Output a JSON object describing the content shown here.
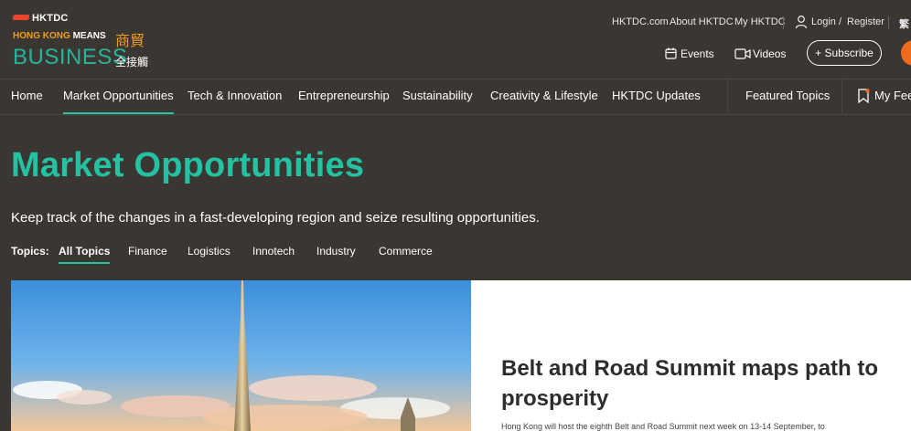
{
  "logo": {
    "brand": "HKTDC",
    "tagline_orange": "HONG KONG",
    "tagline_white": "MEANS",
    "tagline_chinese": "商貿",
    "business": "BUSINESS",
    "business_chinese": "全接觸"
  },
  "utility_links": [
    "HKTDC.com",
    "About HKTDC",
    "My HKTDC"
  ],
  "login": {
    "login_label": "Login",
    "slash": "/",
    "register_label": "Register"
  },
  "language": "繁",
  "actions": {
    "events_label": "Events",
    "videos_label": "Videos",
    "subscribe_label": "+ Subscribe"
  },
  "nav": {
    "items": [
      "Home",
      "Market Opportunities",
      "Tech & Innovation",
      "Entrepreneurship",
      "Sustainability",
      "Creativity & Lifestyle",
      "HKTDC Updates"
    ],
    "active": "Market Opportunities",
    "featured_topics": "Featured Topics",
    "my_feed": "My Feed"
  },
  "page": {
    "title": "Market Opportunities",
    "subtitle": "Keep track of the changes in a fast-developing region and seize resulting opportunities."
  },
  "topics": {
    "label": "Topics:",
    "items": [
      "All Topics",
      "Finance",
      "Logistics",
      "Innotech",
      "Industry",
      "Commerce"
    ],
    "active": "All Topics"
  },
  "feature": {
    "title": "Belt and Road Summit maps path to prosperity",
    "description": "Hong Kong will host the eighth Belt and Road Summit next week on 13-14 September, to"
  },
  "colors": {
    "accent": "#25c4a4",
    "header_bg": "#3a3632",
    "brand_orange": "#f39c1f",
    "avatar": "#f06a1e"
  }
}
